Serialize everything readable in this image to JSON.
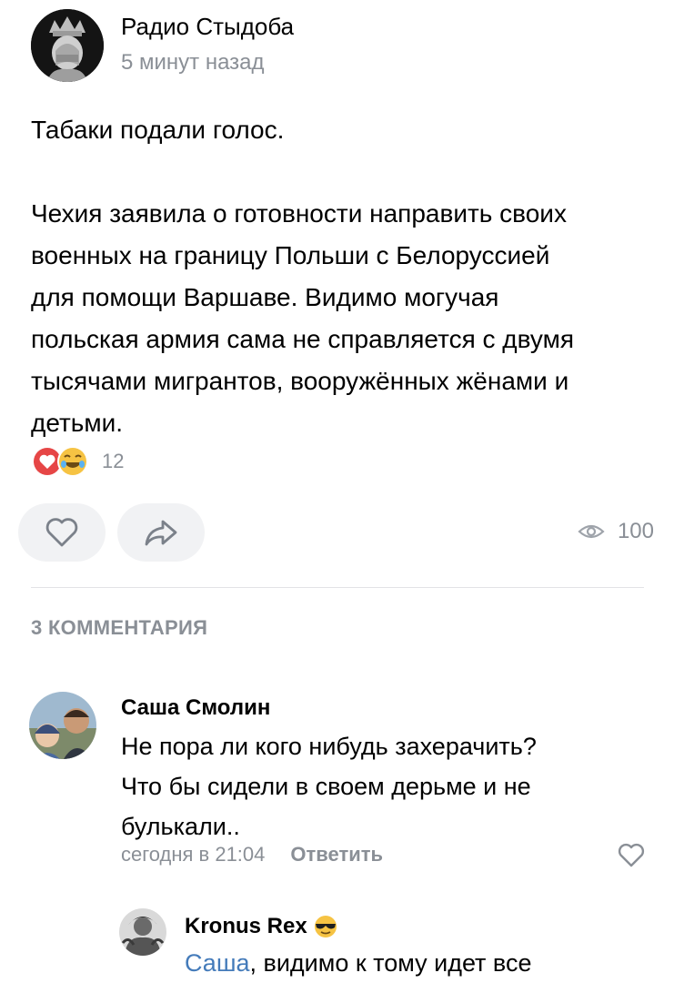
{
  "post": {
    "author": "Радио Стыдоба",
    "time": "5 минут назад",
    "line1": "Табаки подали голос.",
    "paragraph": [
      "Чехия заявила о готовности направить своих",
      "военных на границу Польши с Белоруссией",
      "для помощи Варшаве. Видимо могучая",
      "польская армия сама не справляется с двумя",
      "тысячами мигрантов, вооружённых жёнами и",
      "детьми."
    ],
    "reactions_count": "12",
    "views_count": "100"
  },
  "comments": {
    "heading": "3 КОММЕНТАРИЯ",
    "items": [
      {
        "author": "Саша Смолин",
        "lines": [
          "Не пора ли кого нибудь захерачить?",
          "Что бы сидели в своем дерьме и не",
          "булькали.."
        ],
        "time": "сегодня в 21:04",
        "reply_label": "Ответить"
      },
      {
        "author": "Kronus Rex",
        "mention": "Саша",
        "text": ", видимо к тому идет все"
      }
    ]
  },
  "colors": {
    "secondary_text": "#8a8f96",
    "button_bg": "#f1f2f4",
    "link": "#447bba",
    "heart_red": "#e64646"
  }
}
